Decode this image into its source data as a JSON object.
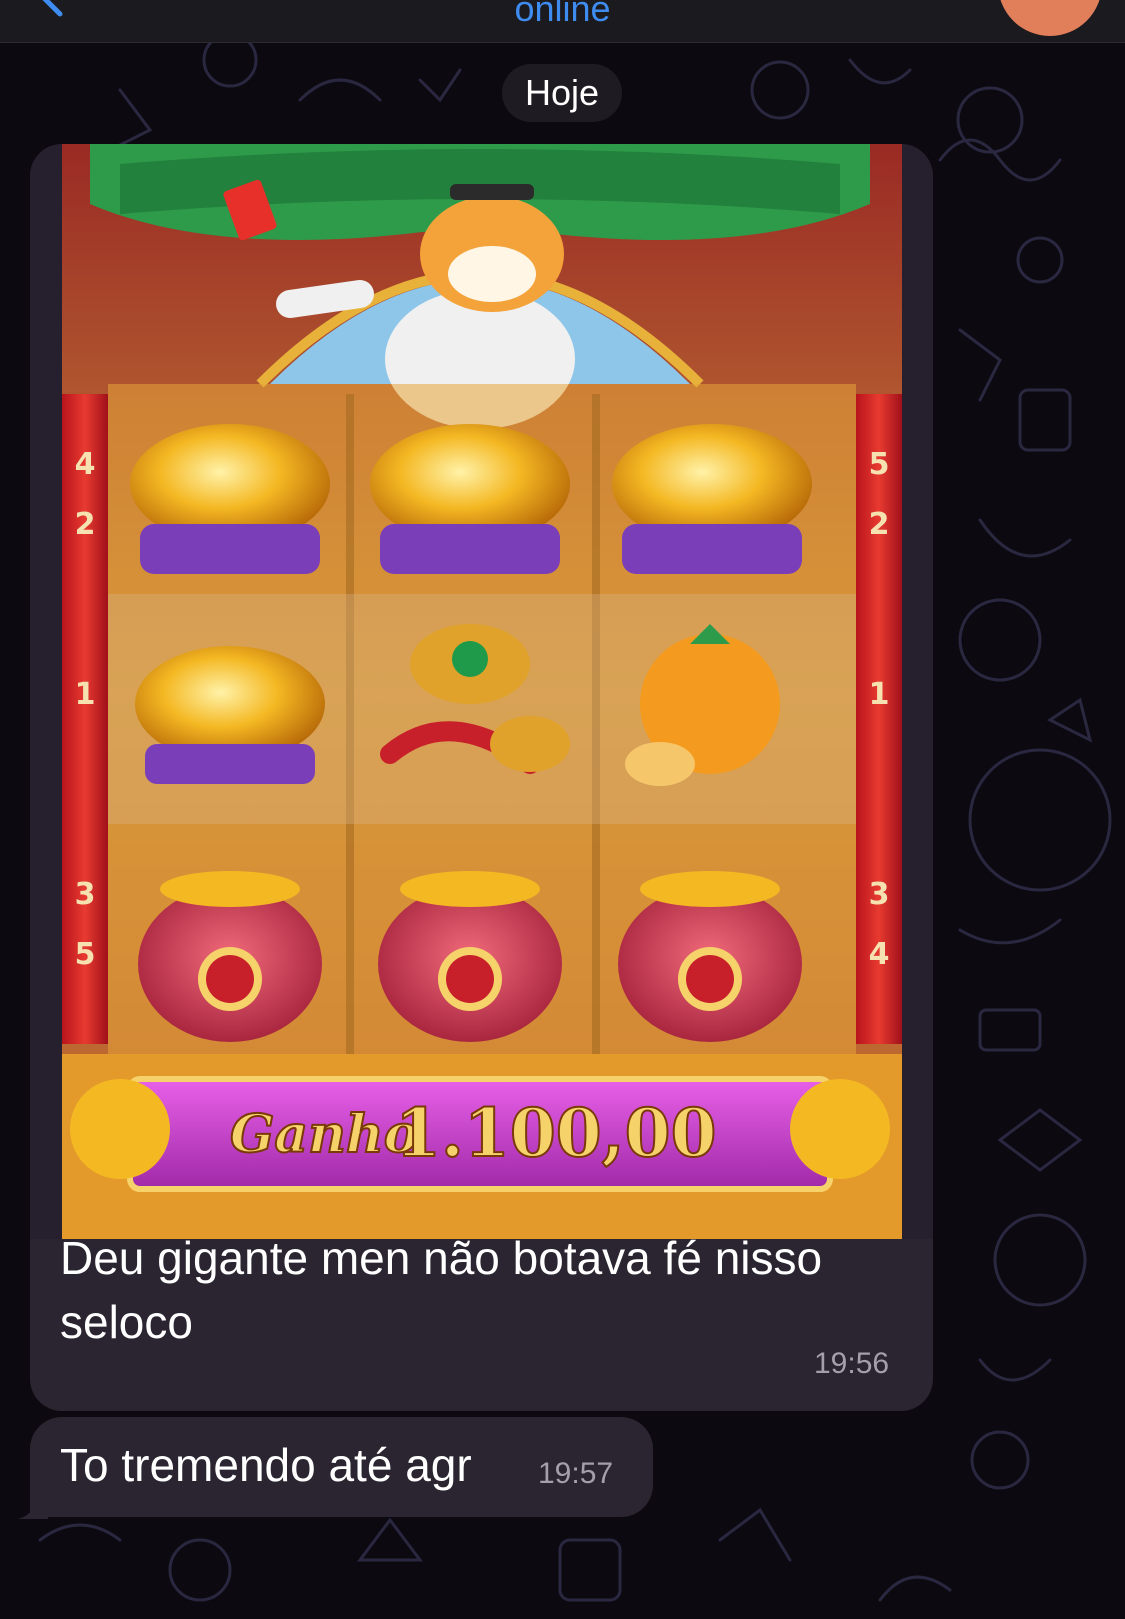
{
  "header": {
    "status": "online",
    "accent_color": "#3f8cf0",
    "avatar_color": "#e07f5a"
  },
  "date_separator": "Hoje",
  "game": {
    "win_label": "Ganho",
    "win_amount": "1.100,00",
    "left_column_numbers": [
      "4",
      "2",
      "1",
      "3",
      "5"
    ],
    "right_column_numbers": [
      "5",
      "2",
      "1",
      "3",
      "4"
    ]
  },
  "messages": [
    {
      "text_line1": "Deu gigante men não botava fé nisso",
      "text_line2": "seloco",
      "time": "19:56"
    },
    {
      "text": "To tremendo até agr",
      "time": "19:57"
    }
  ],
  "colors": {
    "background": "#0c0a10",
    "bubble": "#2a2530",
    "time_text": "#a59fac"
  }
}
